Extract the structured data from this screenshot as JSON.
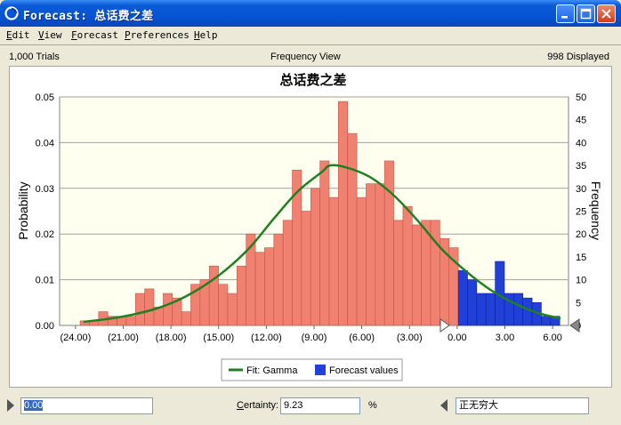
{
  "window": {
    "title": "Forecast: 总话费之差",
    "colors": {
      "titlebar": "#0554D3",
      "close": "#C9421A"
    }
  },
  "menu": [
    "Edit",
    "View",
    "Forecast",
    "Preferences",
    "Help"
  ],
  "info": {
    "trials": "1,000 Trials",
    "view": "Frequency View",
    "displayed": "998 Displayed"
  },
  "chart_data": {
    "type": "bar",
    "title": "总话费之差",
    "ylabel": "Probability",
    "y2label": "Frequency",
    "xlim": [
      -25,
      7
    ],
    "ylim": [
      0,
      0.05
    ],
    "y2lim": [
      0,
      50
    ],
    "x_ticks": [
      "(24.00)",
      "(21.00)",
      "(18.00)",
      "(15.00)",
      "(12.00)",
      "(9.00)",
      "(6.00)",
      "(3.00)",
      "0.00",
      "3.00",
      "6.00"
    ],
    "y_ticks": [
      "0.00",
      "0.01",
      "0.02",
      "0.03",
      "0.04",
      "0.05"
    ],
    "y2_ticks": [
      "0",
      "5",
      "10",
      "15",
      "20",
      "25",
      "30",
      "35",
      "40",
      "45",
      "50"
    ],
    "bin_width": 0.58,
    "series": [
      {
        "name": "Forecast values",
        "color": "#F08070",
        "x": [
          -23.42,
          -22.84,
          -22.26,
          -21.68,
          -21.1,
          -20.52,
          -19.94,
          -19.36,
          -18.78,
          -18.2,
          -17.62,
          -17.04,
          -16.46,
          -15.88,
          -15.3,
          -14.72,
          -14.14,
          -13.56,
          -12.98,
          -12.4,
          -11.82,
          -11.24,
          -10.66,
          -10.08,
          -9.5,
          -8.92,
          -8.34,
          -7.76,
          -7.18,
          -6.6,
          -6.02,
          -5.44,
          -4.86,
          -4.28,
          -3.7,
          -3.12,
          -2.54,
          -1.96,
          -1.38,
          -0.8,
          -0.22
        ],
        "values": [
          1,
          1,
          3,
          2,
          2,
          2,
          7,
          8,
          4,
          7,
          6,
          3,
          9,
          10,
          13,
          9,
          7,
          13,
          20,
          16,
          17,
          20,
          23,
          34,
          25,
          30,
          36,
          28,
          49,
          42,
          28,
          31,
          31,
          36,
          23,
          26,
          22,
          23,
          23,
          19,
          17
        ]
      },
      {
        "name": "Forecast values (right of certainty)",
        "color": "#2040D8",
        "x": [
          0.36,
          0.94,
          1.52,
          2.1,
          2.68,
          3.26,
          3.84,
          4.42,
          5.0,
          5.58,
          6.16
        ],
        "values": [
          12,
          10,
          7,
          7,
          14,
          7,
          7,
          6,
          5,
          2,
          2
        ]
      }
    ],
    "fit": {
      "name": "Fit: Gamma",
      "color": "#208020",
      "x": [
        -23.5,
        -22,
        -20.5,
        -19,
        -17.5,
        -16,
        -14.5,
        -13,
        -11.5,
        -10,
        -8.5,
        -8,
        -7,
        -5.5,
        -4,
        -2.5,
        -1,
        0.5,
        2,
        3.5,
        5,
        6.5
      ],
      "values": [
        0.8,
        1.4,
        2.3,
        3.6,
        5.6,
        8.5,
        12.3,
        17.2,
        23.5,
        29.4,
        33.6,
        35,
        34.6,
        32.5,
        28.5,
        23,
        16.8,
        12,
        8,
        5,
        2.8,
        1.5
      ]
    },
    "legend": [
      "Fit: Gamma",
      "Forecast values"
    ],
    "legend_position": "bottom-center"
  },
  "bottom": {
    "lower_value": "0.00",
    "certainty_label": "Certainty:",
    "certainty_value": "9.23",
    "percent": "%",
    "upper_value": "正无穷大"
  }
}
